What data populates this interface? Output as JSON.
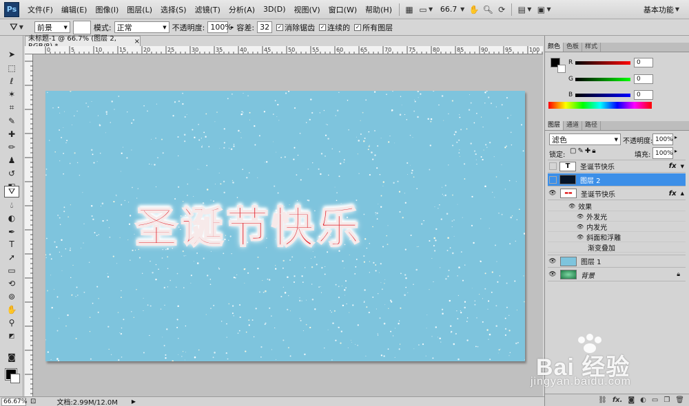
{
  "menubar": {
    "logo": "Ps",
    "items": [
      "文件(F)",
      "编辑(E)",
      "图像(I)",
      "图层(L)",
      "选择(S)",
      "滤镜(T)",
      "分析(A)",
      "3D(D)",
      "视图(V)",
      "窗口(W)",
      "帮助(H)"
    ],
    "zoom": "66.7",
    "workspace": "基本功能"
  },
  "options": {
    "fill_source": "前景",
    "mode_label": "模式:",
    "mode_value": "正常",
    "opacity_label": "不透明度:",
    "opacity_value": "100%",
    "tolerance_label": "容差:",
    "tolerance_value": "32",
    "antialias_label": "消除锯齿",
    "contiguous_label": "连续的",
    "all_layers_label": "所有图层"
  },
  "document": {
    "tab_title": "未标题-1 @ 66.7% (图层 2, RGB/8) *",
    "tab_close": "×",
    "ruler_labels": [
      "0",
      "5",
      "10",
      "15",
      "20",
      "25",
      "30",
      "35",
      "40",
      "45",
      "50",
      "55",
      "60",
      "65",
      "70",
      "75",
      "80",
      "85",
      "90",
      "95",
      "100"
    ],
    "canvas_text": "圣诞节快乐",
    "canvas_color": "#7ec4dd",
    "text_color": "#e01a23"
  },
  "status": {
    "zoom": "66.67%",
    "doc_size": "文档:2.99M/12.0M"
  },
  "color_panel": {
    "tabs": [
      "颜色",
      "色板",
      "样式"
    ],
    "channels": [
      {
        "label": "R",
        "value": "0"
      },
      {
        "label": "G",
        "value": "0"
      },
      {
        "label": "B",
        "value": "0"
      }
    ]
  },
  "layers_panel": {
    "tabs": [
      "图层",
      "通道",
      "路径"
    ],
    "blend_mode": "滤色",
    "opacity_label": "不透明度:",
    "opacity_value": "100%",
    "lock_label": "锁定:",
    "fill_label": "填充:",
    "fill_value": "100%",
    "layers": [
      {
        "name": "圣诞节快乐",
        "type": "text",
        "thumb_char": "T",
        "fx": "fx",
        "visible": false,
        "selected": false
      },
      {
        "name": "图层 2",
        "type": "pixel",
        "selected": true,
        "visible": false
      },
      {
        "name": "圣诞节快乐",
        "type": "text",
        "fx": "fx",
        "visible": true,
        "selected": false
      }
    ],
    "effects_label": "效果",
    "effects": [
      "外发光",
      "内发光",
      "斜面和浮雕",
      "渐变叠加"
    ],
    "lower_layers": [
      {
        "name": "图层 1",
        "visible": true
      },
      {
        "name": "背景",
        "visible": true,
        "locked": true
      }
    ],
    "bottom_fx": "fx."
  },
  "watermark": {
    "brand": "Bai 经验",
    "url": "jingyan.baidu.com"
  }
}
